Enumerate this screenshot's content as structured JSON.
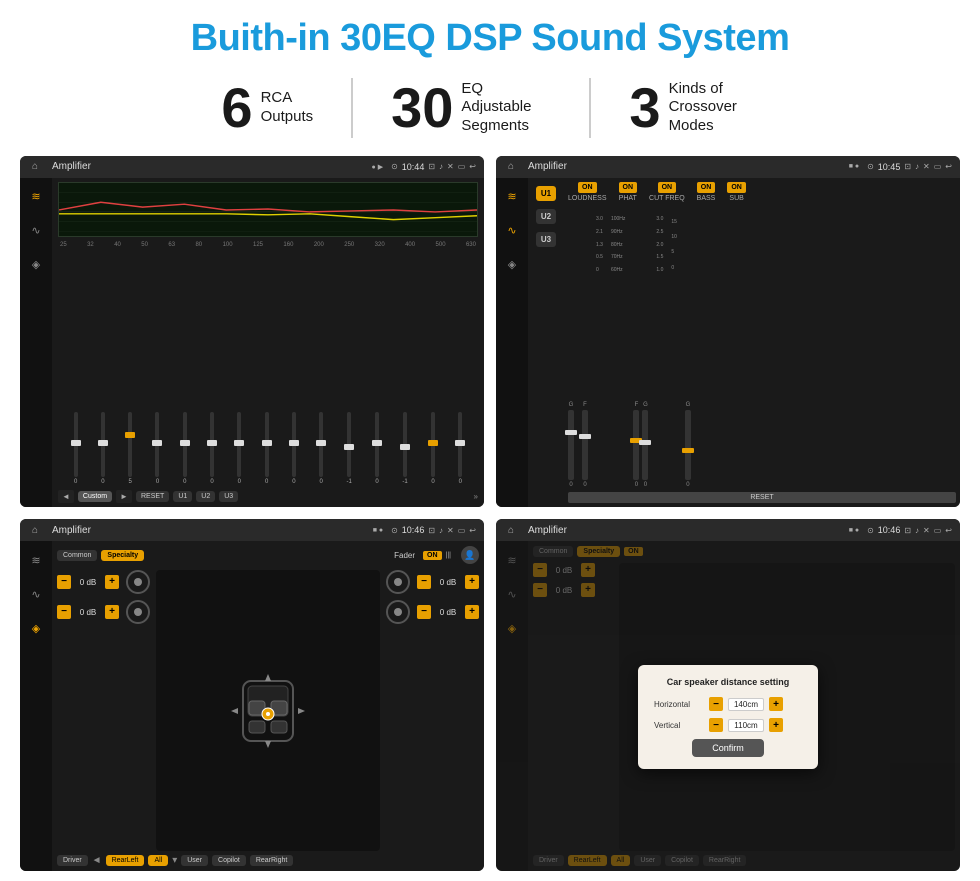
{
  "title": "Buith-in 30EQ DSP Sound System",
  "stats": [
    {
      "number": "6",
      "label": "RCA\nOutputs"
    },
    {
      "number": "30",
      "label": "EQ Adjustable\nSegments"
    },
    {
      "number": "3",
      "label": "Kinds of\nCrossover Modes"
    }
  ],
  "screens": {
    "eq": {
      "status_bar": {
        "title": "Amplifier",
        "time": "10:44"
      },
      "freq_labels": [
        "25",
        "32",
        "40",
        "50",
        "63",
        "80",
        "100",
        "125",
        "160",
        "200",
        "250",
        "320",
        "400",
        "500",
        "630"
      ],
      "slider_values": [
        "0",
        "0",
        "0",
        "5",
        "0",
        "0",
        "0",
        "0",
        "0",
        "0",
        "0",
        "-1",
        "0",
        "-1"
      ],
      "bottom_buttons": [
        "◄",
        "Custom",
        "►",
        "RESET",
        "U1",
        "U2",
        "U3"
      ]
    },
    "crossover": {
      "status_bar": {
        "title": "Amplifier",
        "time": "10:45"
      },
      "u_buttons": [
        "U1",
        "U2",
        "U3"
      ],
      "on_labels": [
        "LOUDNESS",
        "PHAT",
        "CUT FREQ",
        "BASS",
        "SUB"
      ],
      "reset_label": "RESET"
    },
    "fader": {
      "status_bar": {
        "title": "Amplifier",
        "time": "10:46"
      },
      "mode_buttons": [
        "Common",
        "Specialty"
      ],
      "fader_label": "Fader",
      "on_badge": "ON",
      "db_values": [
        "0 dB",
        "0 dB",
        "0 dB",
        "0 dB"
      ],
      "bottom_buttons": [
        "Driver",
        "RearLeft",
        "All",
        "User",
        "Copilot",
        "RearRight"
      ]
    },
    "distance": {
      "status_bar": {
        "title": "Amplifier",
        "time": "10:46"
      },
      "mode_buttons": [
        "Common",
        "Specialty"
      ],
      "on_badge": "ON",
      "dialog": {
        "title": "Car speaker distance setting",
        "horizontal_label": "Horizontal",
        "horizontal_value": "140cm",
        "vertical_label": "Vertical",
        "vertical_value": "110cm",
        "confirm_label": "Confirm"
      },
      "db_values": [
        "0 dB",
        "0 dB"
      ],
      "bottom_buttons": [
        "Driver",
        "RearLeft",
        "All",
        "User",
        "Copilot",
        "RearRight"
      ]
    }
  },
  "icons": {
    "home": "⌂",
    "back": "↩",
    "menu": "☰",
    "equalizer": "≋",
    "wave": "∿",
    "speaker": "◈",
    "location": "⊙",
    "camera": "⊡",
    "volume": "♪",
    "x": "✕",
    "window": "▭",
    "chevron_right": "»",
    "chevron_down": "▾",
    "chevron_up": "▴",
    "plus": "+",
    "minus": "−"
  }
}
